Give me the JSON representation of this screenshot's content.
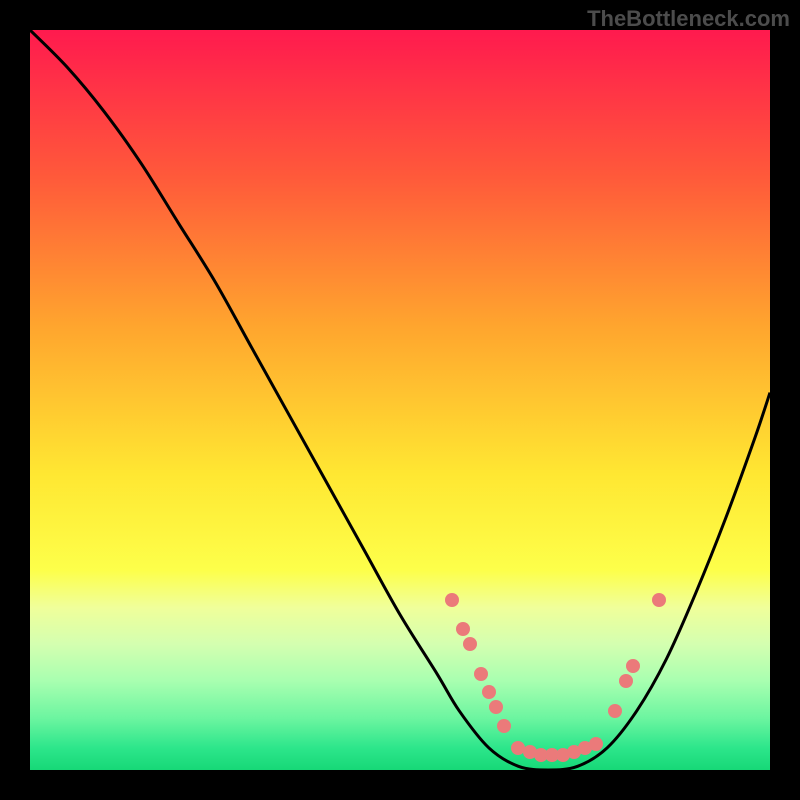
{
  "watermark": "TheBottleneck.com",
  "chart_data": {
    "type": "line",
    "title": "",
    "xlabel": "",
    "ylabel": "",
    "xlim": [
      0,
      100
    ],
    "ylim": [
      0,
      100
    ],
    "background": {
      "type": "vertical-gradient",
      "stops": [
        {
          "pos": 0,
          "color": "#ff1a4e"
        },
        {
          "pos": 20,
          "color": "#ff5a3a"
        },
        {
          "pos": 40,
          "color": "#ffa52e"
        },
        {
          "pos": 60,
          "color": "#ffe732"
        },
        {
          "pos": 73,
          "color": "#fdff4a"
        },
        {
          "pos": 78,
          "color": "#f0ff9a"
        },
        {
          "pos": 83,
          "color": "#d4ffb0"
        },
        {
          "pos": 88,
          "color": "#a8ffb0"
        },
        {
          "pos": 93,
          "color": "#6cf5a0"
        },
        {
          "pos": 97,
          "color": "#2de68b"
        },
        {
          "pos": 100,
          "color": "#17d877"
        }
      ]
    },
    "series": [
      {
        "name": "bottleneck-curve",
        "color": "#000000",
        "x": [
          0,
          5,
          10,
          15,
          20,
          25,
          30,
          35,
          40,
          45,
          50,
          55,
          58,
          62,
          66,
          70,
          74,
          78,
          82,
          86,
          90,
          94,
          98,
          100
        ],
        "y": [
          100,
          95,
          89,
          82,
          74,
          66,
          57,
          48,
          39,
          30,
          21,
          13,
          8,
          3,
          0.5,
          0,
          0.5,
          3,
          8,
          15,
          24,
          34,
          45,
          51
        ]
      }
    ],
    "scatter_points": {
      "name": "highlight-dots",
      "color": "#eb7a7a",
      "points": [
        {
          "x": 57,
          "y": 23
        },
        {
          "x": 58.5,
          "y": 19
        },
        {
          "x": 59.5,
          "y": 17
        },
        {
          "x": 61,
          "y": 13
        },
        {
          "x": 62,
          "y": 10.5
        },
        {
          "x": 63,
          "y": 8.5
        },
        {
          "x": 64,
          "y": 6
        },
        {
          "x": 66,
          "y": 3
        },
        {
          "x": 67.5,
          "y": 2.5
        },
        {
          "x": 69,
          "y": 2
        },
        {
          "x": 70.5,
          "y": 2
        },
        {
          "x": 72,
          "y": 2
        },
        {
          "x": 73.5,
          "y": 2.5
        },
        {
          "x": 75,
          "y": 3
        },
        {
          "x": 76.5,
          "y": 3.5
        },
        {
          "x": 79,
          "y": 8
        },
        {
          "x": 80.5,
          "y": 12
        },
        {
          "x": 81.5,
          "y": 14
        },
        {
          "x": 85,
          "y": 23
        }
      ]
    }
  }
}
